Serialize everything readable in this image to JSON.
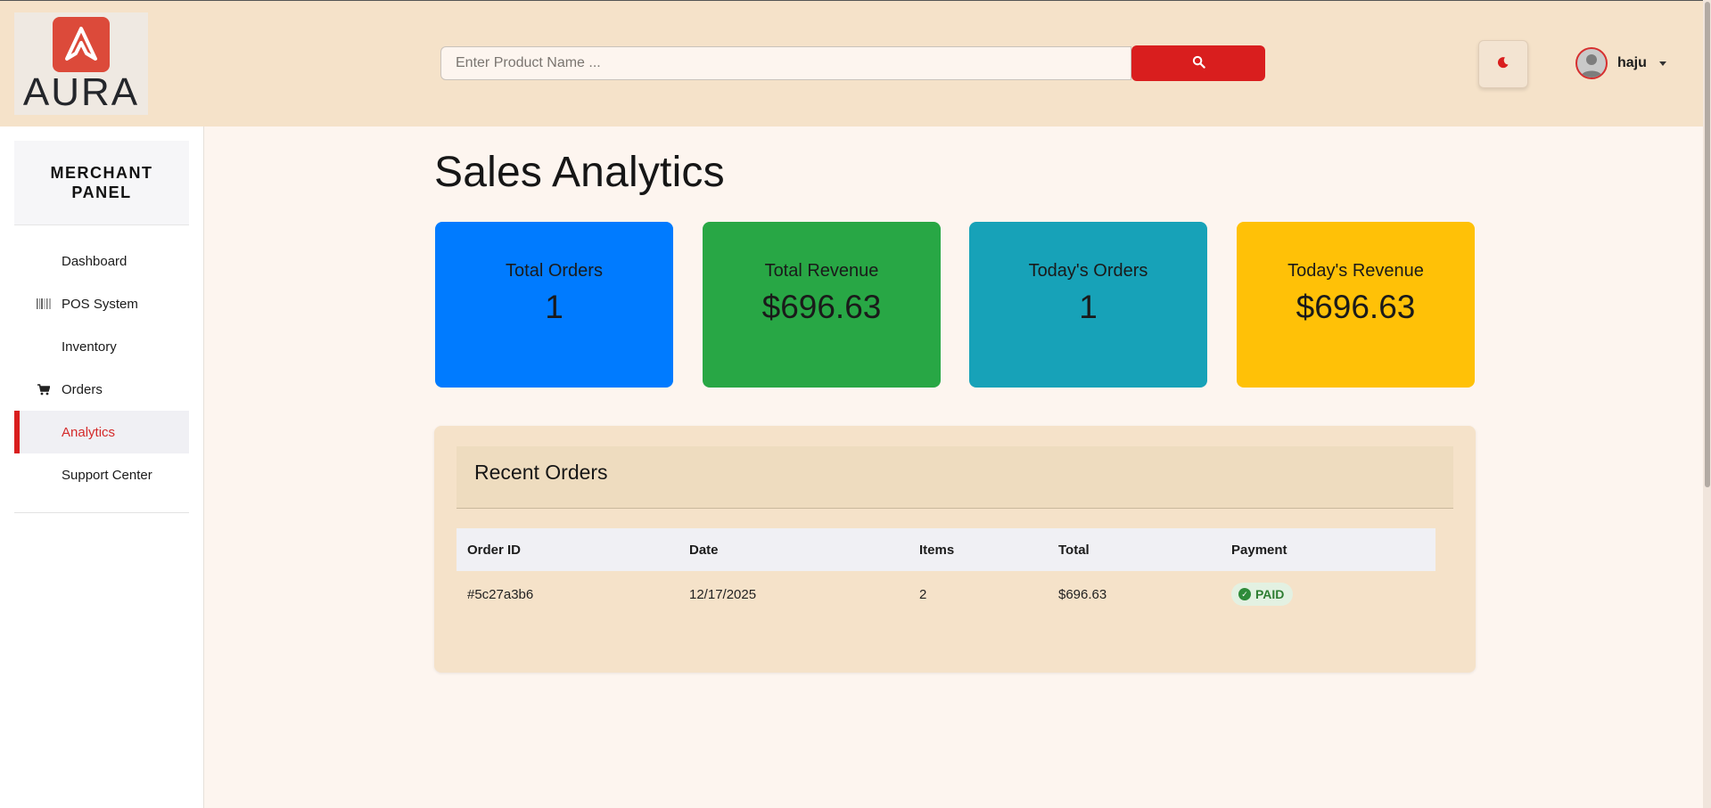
{
  "header": {
    "logo_text": "AURA",
    "search_placeholder": "Enter Product Name ...",
    "search_icon": "search-icon",
    "theme_icon": "moon-icon",
    "user": {
      "name": "haju",
      "avatar_icon": "user-avatar-icon"
    }
  },
  "sidebar": {
    "panel_title_line1": "MERCHANT",
    "panel_title_line2": "PANEL",
    "items": [
      {
        "label": "Dashboard",
        "icon": ""
      },
      {
        "label": "POS System",
        "icon": "barcode-icon"
      },
      {
        "label": "Inventory",
        "icon": ""
      },
      {
        "label": "Orders",
        "icon": "cart-icon"
      },
      {
        "label": "Analytics",
        "icon": "",
        "active": true
      },
      {
        "label": "Support Center",
        "icon": ""
      }
    ]
  },
  "main": {
    "title": "Sales Analytics",
    "stats": [
      {
        "label": "Total Orders",
        "value": "1",
        "color": "#007bff"
      },
      {
        "label": "Total Revenue",
        "value": "$696.63",
        "color": "#28a745"
      },
      {
        "label": "Today's Orders",
        "value": "1",
        "color": "#17a2b8"
      },
      {
        "label": "Today's Revenue",
        "value": "$696.63",
        "color": "#ffc107"
      }
    ],
    "recent_orders": {
      "title": "Recent Orders",
      "columns": [
        "Order ID",
        "Date",
        "Items",
        "Total",
        "Payment"
      ],
      "rows": [
        {
          "order_id": "#5c27a3b6",
          "date": "12/17/2025",
          "items": "2",
          "total": "$696.63",
          "payment": "PAID"
        }
      ]
    }
  },
  "colors": {
    "header_bg": "#f5e2c9",
    "page_bg": "#fdf5ef",
    "accent": "#d91e1e",
    "paid_badge_text": "#2e7d32"
  }
}
